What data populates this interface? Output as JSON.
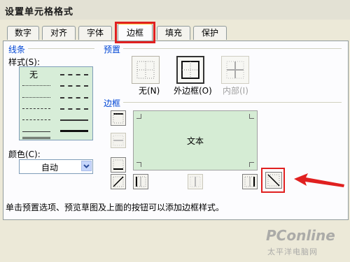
{
  "dialog": {
    "title": "设置单元格格式"
  },
  "tabs": [
    {
      "label": "数字"
    },
    {
      "label": "对齐"
    },
    {
      "label": "字体"
    },
    {
      "label": "边框",
      "active": true
    },
    {
      "label": "填充"
    },
    {
      "label": "保护"
    }
  ],
  "line_group": {
    "title": "线条",
    "style_label": "样式(S):",
    "none_option": "无",
    "color_label": "颜色(C):",
    "color_value": "自动"
  },
  "presets": {
    "title": "预置",
    "none_label": "无(N)",
    "outline_label": "外边框(O)",
    "inside_label": "内部(I)"
  },
  "border": {
    "title": "边框",
    "preview_text": "文本"
  },
  "hint_text": "单击预置选项、预览草图及上面的按钮可以添加边框样式。",
  "watermark": {
    "main": "PConline",
    "sub": "太平洋电脑网"
  },
  "colors": {
    "highlight": "#e02020",
    "accent_blue": "#0046d5",
    "preview_bg": "#d5ecd4"
  }
}
